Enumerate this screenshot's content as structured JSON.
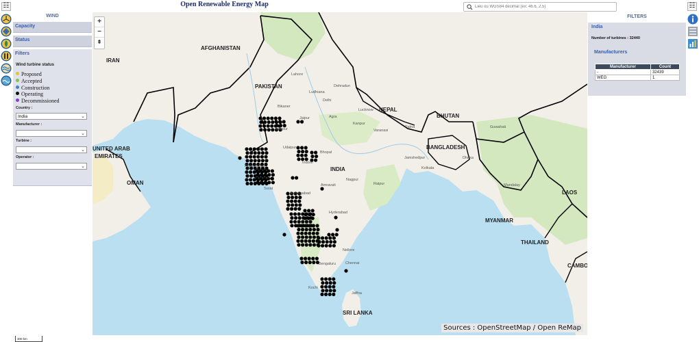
{
  "header": {
    "title": "Open Renewable Energy Map",
    "menu_glyph": "☷",
    "search_placeholder": "Lieu ou WGS84 décimal (ex: 46.6, 2.5)"
  },
  "left_panel": {
    "title": "WIND",
    "capacity_label": "Capacity",
    "status_label": "Status",
    "filters_label": "Filters",
    "wind_turbine_status_title": "Wind turbine status",
    "statuses": [
      {
        "label": "Proposed",
        "color": "#e6c531"
      },
      {
        "label": "Accepted",
        "color": "#7ec843"
      },
      {
        "label": "Construction",
        "color": "#3a86d0"
      },
      {
        "label": "Operating",
        "color": "#111111"
      },
      {
        "label": "Decommissioned",
        "color": "#8a3fc9"
      }
    ],
    "country_label": "Country :",
    "country_value": "India",
    "manufacturer_label": "Manufacturer :",
    "manufacturer_value": "",
    "turbine_label": "Turbine :",
    "turbine_value": "",
    "operator_label": "Operator :",
    "operator_value": ""
  },
  "map": {
    "zoom_in": "+",
    "zoom_out": "−",
    "north": "⇞",
    "attribution": "Sources : OpenStreetMap / Open ReMap",
    "scale": "300 km",
    "country_labels": [
      {
        "text": "AFGHANISTAN"
      },
      {
        "text": "IRAN"
      },
      {
        "text": "PAKISTAN"
      },
      {
        "text": "NEPAL"
      },
      {
        "text": "BHUTAN"
      },
      {
        "text": "INDIA"
      },
      {
        "text": "BANGLADESH"
      },
      {
        "text": "UNITED ARAB"
      },
      {
        "text": "EMIRATES"
      },
      {
        "text": "OMAN"
      },
      {
        "text": "MYANMAR"
      },
      {
        "text": "LAOS"
      },
      {
        "text": "THAILAND"
      },
      {
        "text": "SRI LANKA"
      },
      {
        "text": "CAMBO"
      }
    ],
    "city_labels": [
      "Lahore",
      "Ludhiana",
      "Dehradun",
      "Delhi",
      "Jaipur",
      "Agra",
      "Lucknow",
      "Kanpur",
      "Bhopal",
      "Indore",
      "Ahmedabad",
      "Patna",
      "Kolkata",
      "Nagpur",
      "Amravati",
      "Aurangabad",
      "Hyderabad",
      "Chennai",
      "Bengaluru",
      "Kochi",
      "Jaffna",
      "Surat",
      "Raipur",
      "Dhaka",
      "Mandalay",
      "Varanasi",
      "Jodhpur",
      "Udaipur",
      "Jamshedpur",
      "Guwahati",
      "Bikaner",
      "Nellore"
    ]
  },
  "right_panel": {
    "title": "FILTERS",
    "country": "India",
    "turbine_count_text": "Number of turbines : 32440",
    "manufacturers_label": "Manufacturers",
    "table": {
      "headers": [
        "Manufacturer",
        "Count"
      ],
      "rows": [
        [
          "-",
          "32439"
        ],
        [
          "WEG",
          "1"
        ]
      ]
    }
  },
  "colors": {
    "accent": "#3a5da8",
    "panel_bg": "#cdd2de",
    "water": "#b9dff1",
    "land": "#f2efe9",
    "green": "#cfe6b8",
    "turbine_dot": "#000000"
  }
}
